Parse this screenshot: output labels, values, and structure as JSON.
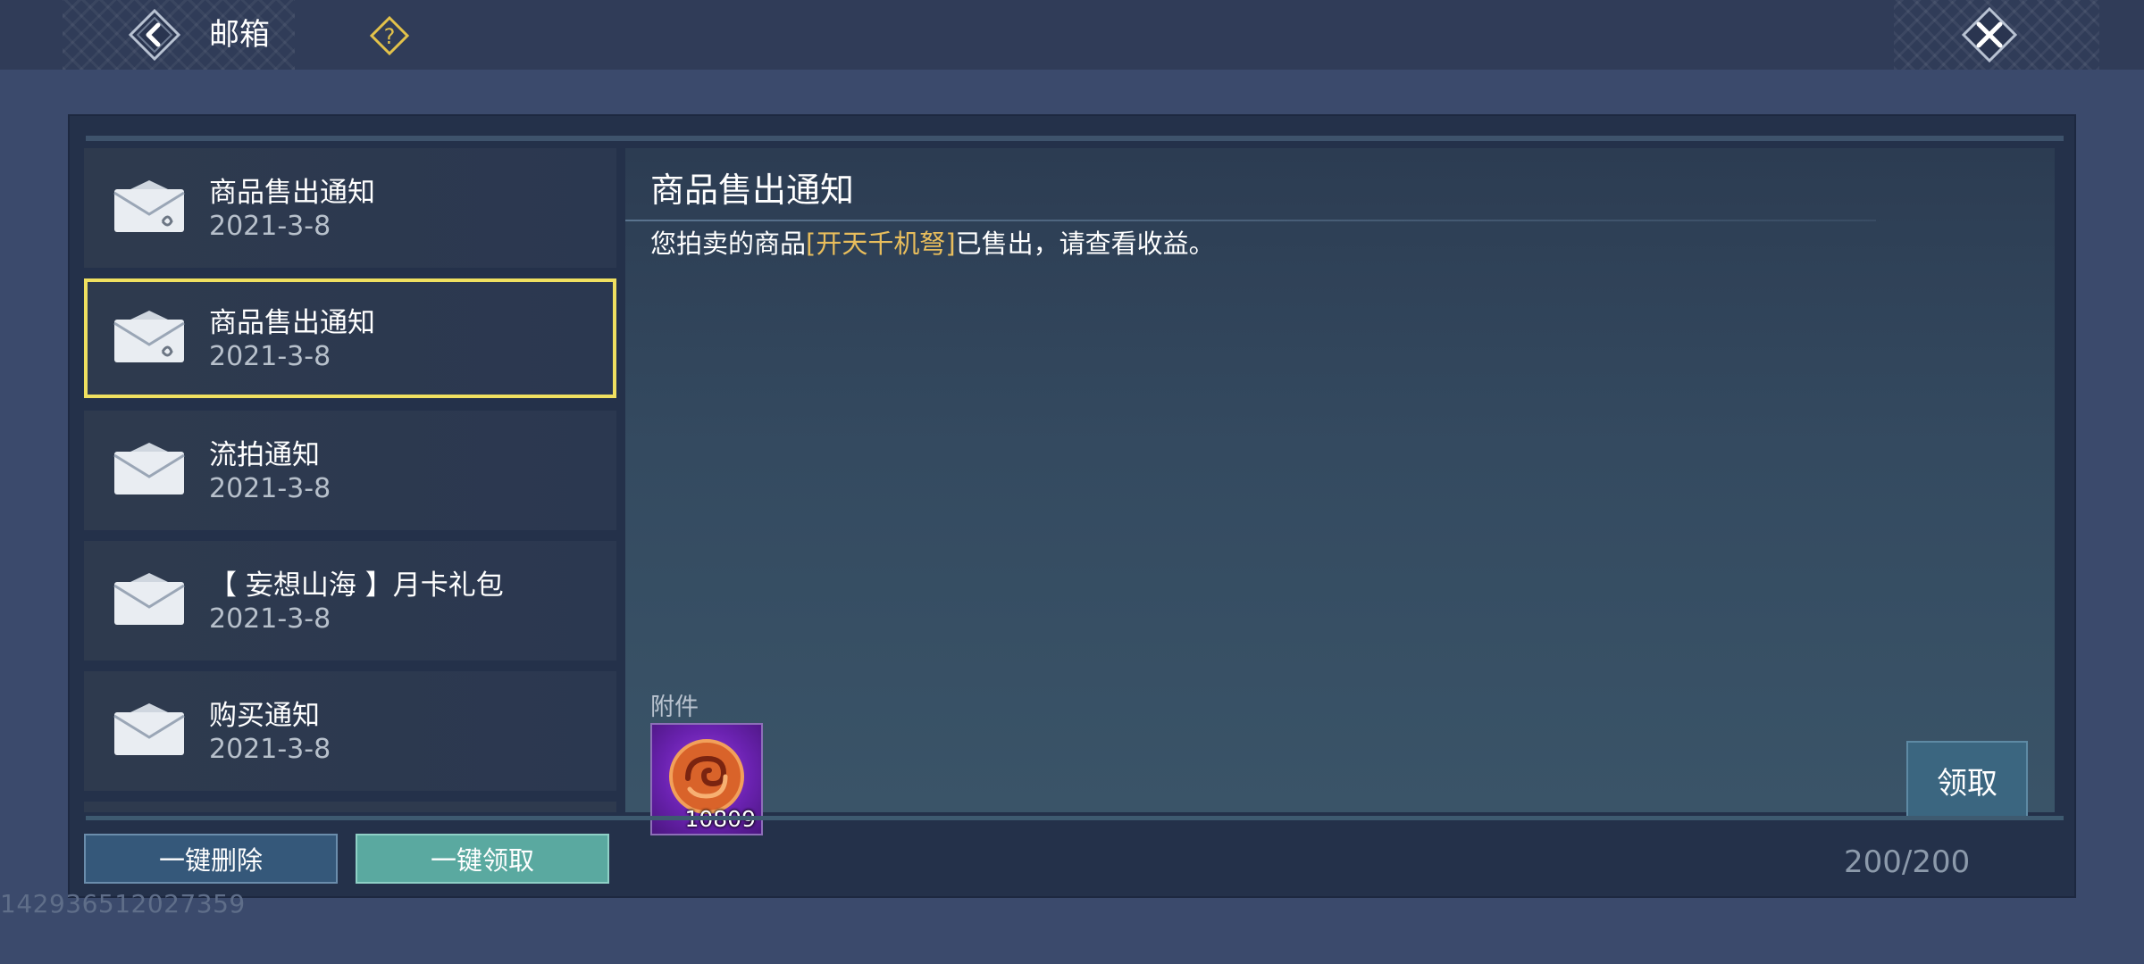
{
  "header": {
    "title": "邮箱",
    "back_icon": "back-arrow-icon",
    "help_icon": "question-diamond-icon",
    "close_icon": "close-x-icon"
  },
  "mail_list": [
    {
      "subject": "商品售出通知",
      "date": "2021-3-8",
      "icon": "envelope-attachment-icon",
      "selected": false
    },
    {
      "subject": "商品售出通知",
      "date": "2021-3-8",
      "icon": "envelope-attachment-icon",
      "selected": true
    },
    {
      "subject": "流拍通知",
      "date": "2021-3-8",
      "icon": "envelope-icon",
      "selected": false
    },
    {
      "subject": "【 妄想山海 】月卡礼包",
      "date": "2021-3-8",
      "icon": "envelope-icon",
      "selected": false
    },
    {
      "subject": "购买通知",
      "date": "2021-3-8",
      "icon": "envelope-icon",
      "selected": false
    }
  ],
  "mail_detail": {
    "title": "商品售出通知",
    "body_prefix": "您拍卖的商品",
    "body_item": "[开天千机弩]",
    "body_suffix": "已售出，请查看收益。",
    "attachment_label": "附件",
    "attachment": {
      "icon": "currency-swirl-icon",
      "count": "10809"
    },
    "claim_label": "领取"
  },
  "footer": {
    "delete_all_label": "一键删除",
    "claim_all_label": "一键领取",
    "mail_count": "200/200"
  },
  "user_id": "142936512027359",
  "colors": {
    "selected_border": "#f0e060",
    "item_highlight": "#e8bd5c",
    "claim_all_button": "#5aa9a0",
    "delete_all_button": "#35587a",
    "claim_button": "#3b6680"
  }
}
